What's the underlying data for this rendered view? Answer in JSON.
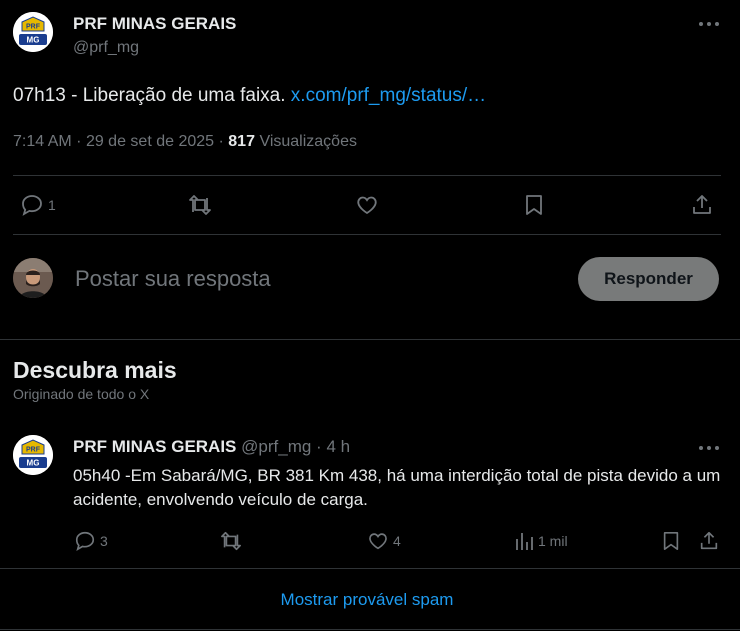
{
  "tweet": {
    "author_name": "PRF MINAS GERAIS",
    "author_handle": "@prf_mg",
    "avatar_badge_top": "PRF",
    "avatar_badge_bottom": "MG",
    "text": "07h13 - Liberação de uma faixa.",
    "link": "x.com/prf_mg/status/…",
    "time": "7:14 AM",
    "date": "29 de set de 2025",
    "views_count": "817",
    "views_label": "Visualizações",
    "reply_count": "1",
    "more_icon": "more-dots-icon"
  },
  "reply_box": {
    "placeholder": "Postar sua resposta",
    "button_label": "Responder"
  },
  "discover": {
    "title": "Descubra mais",
    "subtitle": "Originado de todo o X"
  },
  "related_tweet": {
    "author_name": "PRF MINAS GERAIS",
    "author_handle": "@prf_mg",
    "separator": "·",
    "age": "4 h",
    "avatar_badge_top": "PRF",
    "avatar_badge_bottom": "MG",
    "text": "05h40 -Em Sabará/MG, BR 381 Km 438, há uma interdição total de pista devido a um acidente, envolvendo veículo de carga.",
    "reply_count": "3",
    "like_count": "4",
    "views": "1 mil"
  },
  "spam_link": "Mostrar provável spam",
  "colors": {
    "background": "#000000",
    "text": "#e7e9ea",
    "muted": "#71767b",
    "link": "#1d9bf0",
    "divider": "#2f3336",
    "reply_button": "#787a7a"
  }
}
